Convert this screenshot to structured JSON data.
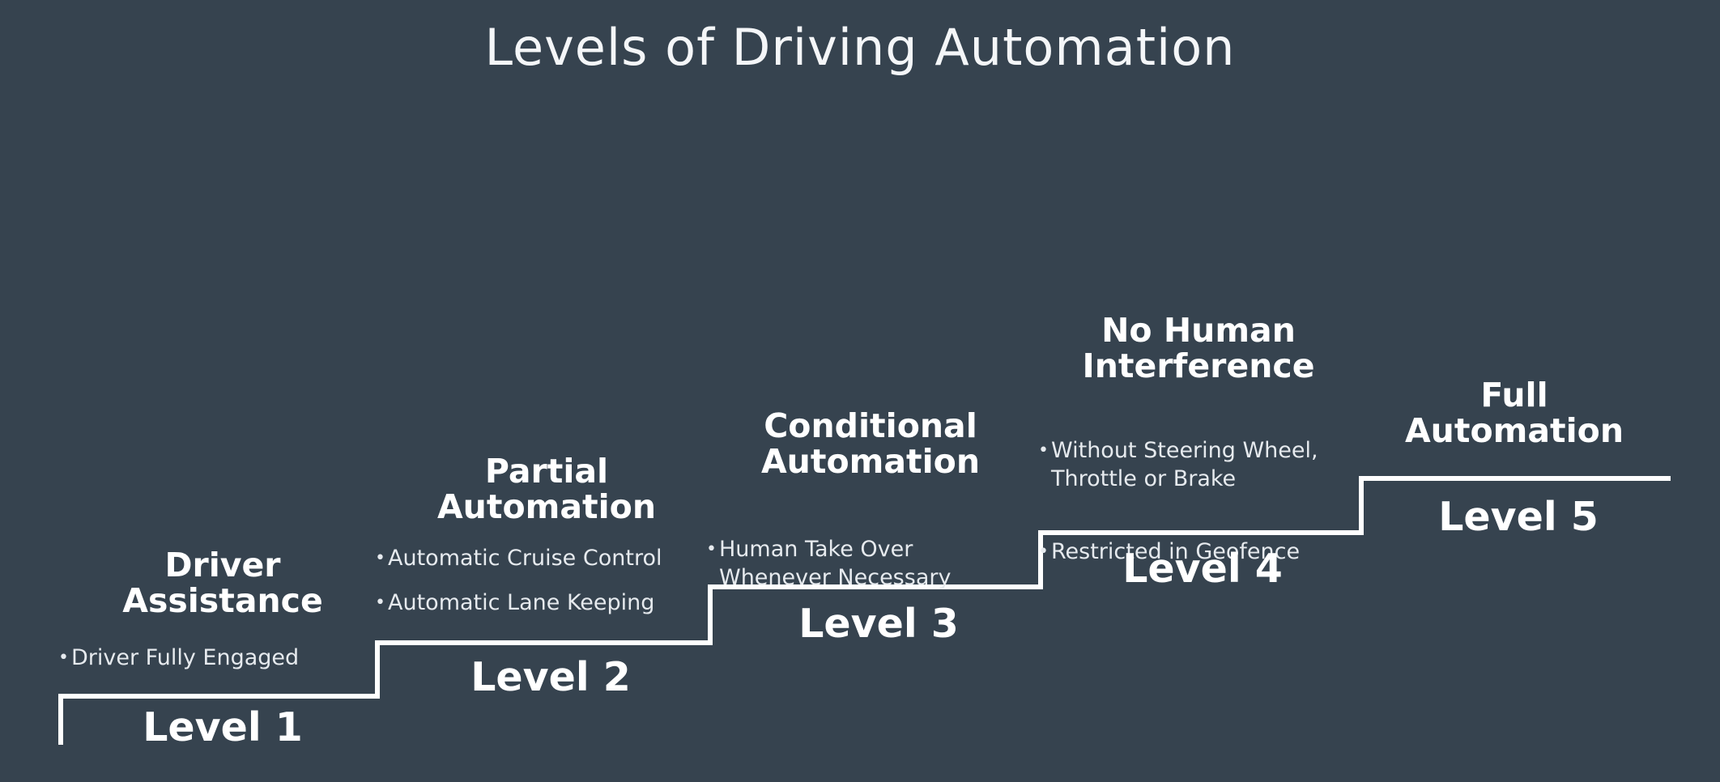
{
  "title": "Levels of Driving Automation",
  "levels": [
    {
      "label": "Level 1",
      "heading": [
        "Driver",
        "Assistance"
      ],
      "bullets": [
        "Driver Fully Engaged"
      ]
    },
    {
      "label": "Level 2",
      "heading": [
        "Partial",
        "Automation"
      ],
      "bullets": [
        "Automatic Cruise Control",
        "Automatic Lane Keeping"
      ]
    },
    {
      "label": "Level 3",
      "heading": [
        "Conditional",
        "Automation"
      ],
      "bullets": [
        "Human Take Over\nWhenever Necessary"
      ]
    },
    {
      "label": "Level 4",
      "heading": [
        "No Human",
        "Interference"
      ],
      "bullets": [
        "Without Steering Wheel,\nThrottle or Brake",
        "Restricted in Geofence"
      ]
    },
    {
      "label": "Level 5",
      "heading": [
        "Full",
        "Automation"
      ],
      "bullets": []
    }
  ],
  "colors": {
    "background": "#36434f",
    "line": "#ffffff",
    "text": "#ffffff"
  }
}
